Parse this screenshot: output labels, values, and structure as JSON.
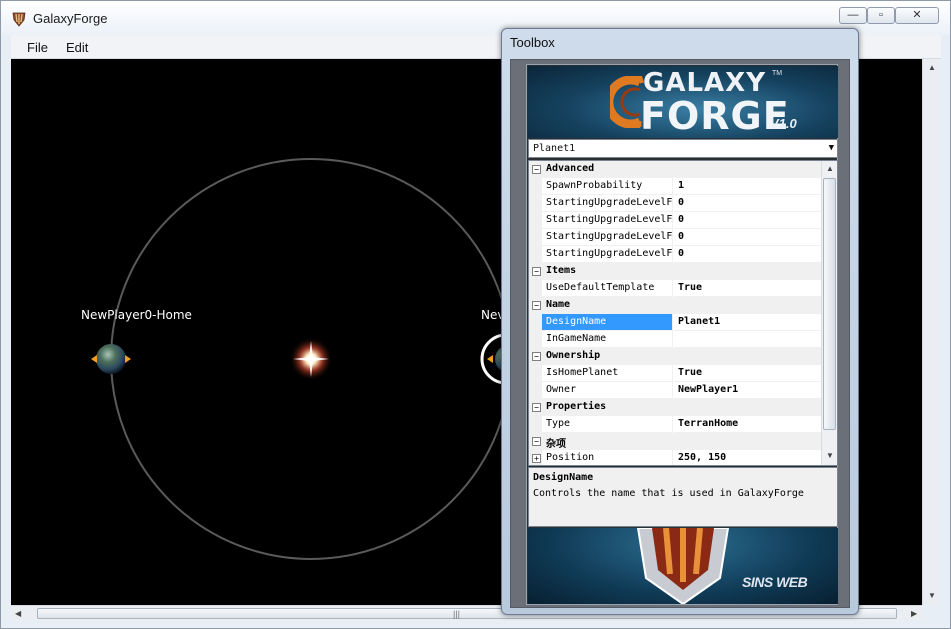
{
  "app": {
    "title": "GalaxyForge",
    "window_controls": {
      "minimize": "—",
      "maximize": "▫",
      "close": "✕"
    }
  },
  "menu": {
    "items": [
      {
        "label": "File"
      },
      {
        "label": "Edit"
      }
    ]
  },
  "canvas": {
    "planet_labels": [
      {
        "text": "NewPlayer0-Home"
      },
      {
        "text": "Nev"
      }
    ]
  },
  "toolbox": {
    "title": "Toolbox",
    "logo": {
      "line1": "GALAXY",
      "line2": "FORGE",
      "version": "V1.0",
      "tm": "TM"
    },
    "selected_object": "Planet1",
    "categories": [
      {
        "label": "Advanced",
        "properties": [
          {
            "name": "SpawnProbability",
            "value": "1"
          },
          {
            "name": "StartingUpgradeLevelF",
            "value": "0"
          },
          {
            "name": "StartingUpgradeLevelF",
            "value": "0"
          },
          {
            "name": "StartingUpgradeLevelF",
            "value": "0"
          },
          {
            "name": "StartingUpgradeLevelF",
            "value": "0"
          }
        ]
      },
      {
        "label": "Items",
        "properties": [
          {
            "name": "UseDefaultTemplate",
            "value": "True"
          }
        ]
      },
      {
        "label": "Name",
        "properties": [
          {
            "name": "DesignName",
            "value": "Planet1",
            "selected": true
          },
          {
            "name": "InGameName",
            "value": ""
          }
        ]
      },
      {
        "label": "Ownership",
        "properties": [
          {
            "name": "IsHomePlanet",
            "value": "True"
          },
          {
            "name": "Owner",
            "value": "NewPlayer1"
          }
        ]
      },
      {
        "label": "Properties",
        "properties": [
          {
            "name": "Type",
            "value": "TerranHome"
          }
        ]
      },
      {
        "label": "杂项",
        "properties": [
          {
            "name": "Position",
            "value": "250, 150",
            "expandable": true
          }
        ]
      }
    ],
    "description": {
      "title": "DesignName",
      "text": "Controls the name that is used in GalaxyForge"
    },
    "bottom_banner": {
      "brand": "SINS WEB"
    }
  },
  "colors": {
    "canvas_bg": "#000000",
    "orbit": "#5a5a5a",
    "selection_highlight": "#3399ff",
    "planet_arrow": "#f0a020"
  }
}
